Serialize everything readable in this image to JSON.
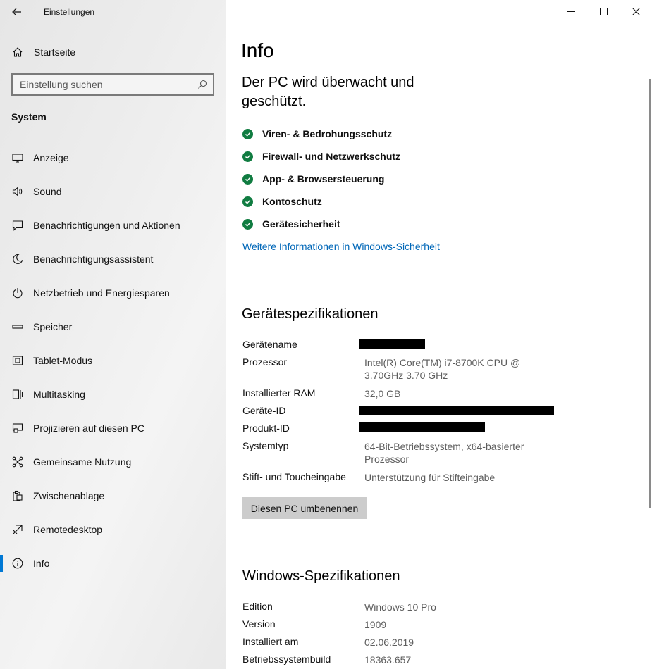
{
  "window": {
    "app_title": "Einstellungen",
    "controls": {
      "minimize": "minimize-icon",
      "maximize": "maximize-icon",
      "close": "close-icon"
    }
  },
  "sidebar": {
    "home_label": "Startseite",
    "search_placeholder": "Einstellung suchen",
    "section_label": "System",
    "items": [
      {
        "label": "Anzeige",
        "icon": "monitor-icon"
      },
      {
        "label": "Sound",
        "icon": "speaker-icon"
      },
      {
        "label": "Benachrichtigungen und Aktionen",
        "icon": "notification-icon"
      },
      {
        "label": "Benachrichtigungsassistent",
        "icon": "moon-icon"
      },
      {
        "label": "Netzbetrieb und Energiesparen",
        "icon": "power-icon"
      },
      {
        "label": "Speicher",
        "icon": "storage-icon"
      },
      {
        "label": "Tablet-Modus",
        "icon": "tablet-icon"
      },
      {
        "label": "Multitasking",
        "icon": "multitasking-icon"
      },
      {
        "label": "Projizieren auf diesen PC",
        "icon": "project-icon"
      },
      {
        "label": "Gemeinsame Nutzung",
        "icon": "share-icon"
      },
      {
        "label": "Zwischenablage",
        "icon": "clipboard-icon"
      },
      {
        "label": "Remotedesktop",
        "icon": "remote-desktop-icon"
      },
      {
        "label": "Info",
        "icon": "info-icon",
        "selected": true
      }
    ]
  },
  "main": {
    "title": "Info",
    "protection_heading": "Der PC wird überwacht und geschützt.",
    "security_items": [
      "Viren- & Bedrohungsschutz",
      "Firewall- und Netzwerkschutz",
      "App- & Browsersteuerung",
      "Kontoschutz",
      "Gerätesicherheit"
    ],
    "security_link": "Weitere Informationen in Windows-Sicherheit",
    "device_specs": {
      "heading": "Gerätespezifikationen",
      "rows": [
        {
          "key": "Gerätename",
          "value": "",
          "redacted": true
        },
        {
          "key": "Prozessor",
          "value": "Intel(R) Core(TM) i7-8700K CPU @ 3.70GHz 3.70 GHz"
        },
        {
          "key": "Installierter RAM",
          "value": "32,0 GB"
        },
        {
          "key": "Geräte-ID",
          "value": "",
          "redacted": true
        },
        {
          "key": "Produkt-ID",
          "value": "",
          "redacted": true
        },
        {
          "key": "Systemtyp",
          "value": "64-Bit-Betriebssystem, x64-basierter Prozessor"
        },
        {
          "key": "Stift- und Toucheingabe",
          "value": "Unterstützung für Stifteingabe"
        }
      ],
      "rename_button": "Diesen PC umbenennen"
    },
    "windows_specs": {
      "heading": "Windows-Spezifikationen",
      "rows": [
        {
          "key": "Edition",
          "value": "Windows 10 Pro"
        },
        {
          "key": "Version",
          "value": "1909"
        },
        {
          "key": "Installiert am",
          "value": "02.06.2019"
        },
        {
          "key": "Betriebssystembuild",
          "value": "18363.657"
        }
      ]
    }
  },
  "colors": {
    "accent": "#0078d4",
    "link": "#0067b8",
    "check_green": "#107c41",
    "button_bg": "#cccccc"
  }
}
